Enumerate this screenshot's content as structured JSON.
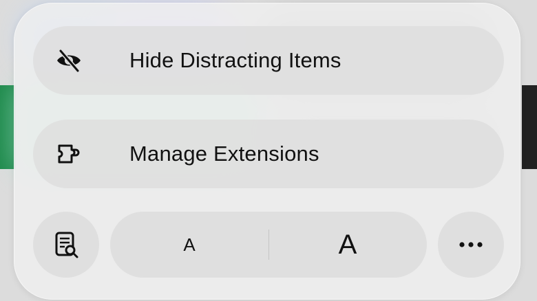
{
  "menu": {
    "items": [
      {
        "label": "Hide Distracting Items",
        "icon": "eye-slash-icon"
      },
      {
        "label": "Manage Extensions",
        "icon": "puzzle-piece-icon"
      }
    ]
  },
  "toolbar": {
    "reader_icon": "reader-search-icon",
    "font_smaller_label": "A",
    "font_larger_label": "A",
    "more_icon": "ellipsis-icon"
  },
  "colors": {
    "sheet_background": "#eeeeee",
    "button_background": "#dedede",
    "text": "#111111"
  }
}
